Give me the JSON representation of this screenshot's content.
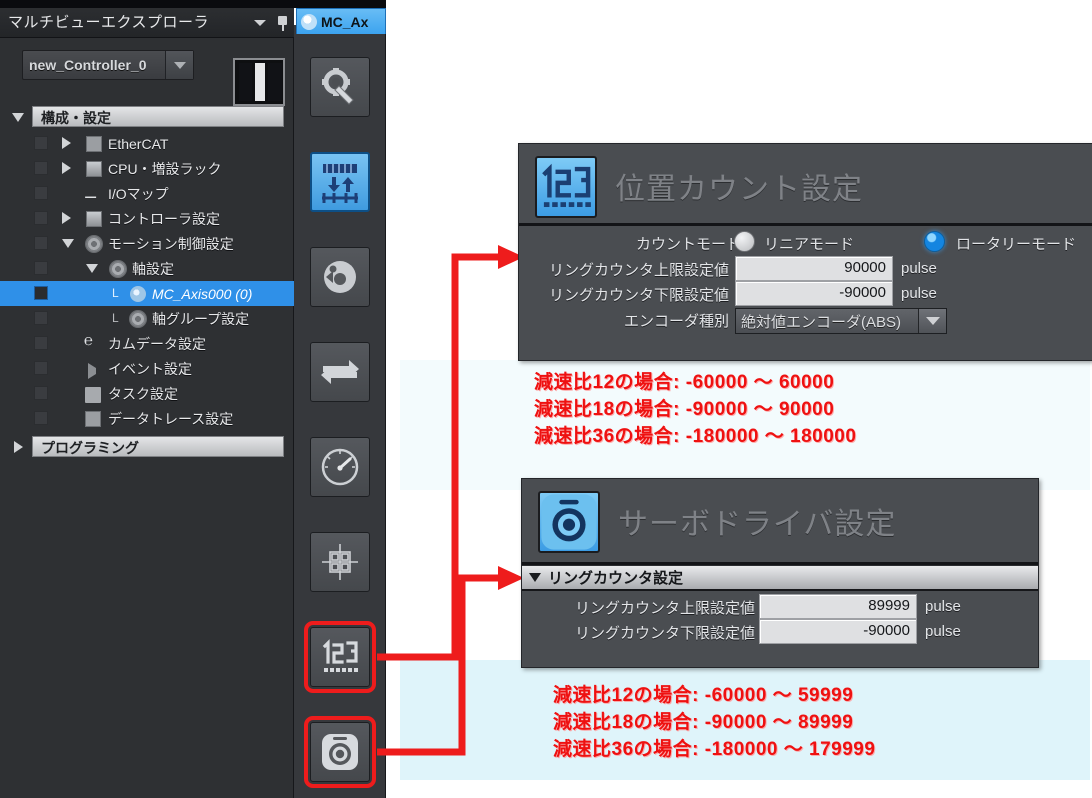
{
  "sidebar": {
    "title": "マルチビューエクスプローラ",
    "collapse_icon": "chevron-down-icon",
    "pin_icon": "pin-icon",
    "controller": {
      "value": "new_Controller_0",
      "dropdown_icon": "chevron-down-icon"
    },
    "tree": [
      {
        "label": "構成・設定",
        "kind": "header",
        "expander": "down",
        "depth": 0,
        "icon": null
      },
      {
        "label": "EtherCAT",
        "kind": "item",
        "expander": "right",
        "depth": 1,
        "icon": "ethercat-icon"
      },
      {
        "label": "CPU・増設ラック",
        "kind": "item",
        "expander": "right",
        "depth": 1,
        "icon": "rack-icon"
      },
      {
        "label": "I/Oマップ",
        "kind": "item",
        "expander": "none",
        "depth": 1,
        "icon": "iomap-icon"
      },
      {
        "label": "コントローラ設定",
        "kind": "item",
        "expander": "right",
        "depth": 1,
        "icon": "controller-icon"
      },
      {
        "label": "モーション制御設定",
        "kind": "item",
        "expander": "down",
        "depth": 1,
        "icon": "motion-icon"
      },
      {
        "label": "軸設定",
        "kind": "item",
        "expander": "down",
        "depth": 2,
        "icon": "axis-settings-icon"
      },
      {
        "label": "MC_Axis000 (0)",
        "kind": "item-selected",
        "expander": "none",
        "depth": 3,
        "icon": "axis-icon"
      },
      {
        "label": "軸グループ設定",
        "kind": "item",
        "expander": "none",
        "depth": 3,
        "icon": "axis-group-icon"
      },
      {
        "label": "カムデータ設定",
        "kind": "item",
        "expander": "none",
        "depth": 2,
        "icon": "cam-icon"
      },
      {
        "label": "イベント設定",
        "kind": "item",
        "expander": "right-small",
        "depth": 2,
        "icon": "event-icon"
      },
      {
        "label": "タスク設定",
        "kind": "item",
        "expander": "none",
        "depth": 2,
        "icon": "task-icon"
      },
      {
        "label": "データトレース設定",
        "kind": "item",
        "expander": "none",
        "depth": 2,
        "icon": "trace-icon"
      },
      {
        "label": "プログラミング",
        "kind": "header",
        "expander": "right",
        "depth": 0,
        "icon": null
      }
    ]
  },
  "tab": {
    "label": "MC_Ax",
    "icon": "axis-icon"
  },
  "rail": {
    "buttons": [
      {
        "name": "axis-basic-settings-button",
        "icon": "gear-wrench-icon",
        "state": "normal"
      },
      {
        "name": "unit-conversion-settings-button",
        "icon": "unit-conversion-icon",
        "state": "selected"
      },
      {
        "name": "operation-settings-button",
        "icon": "operation-icon",
        "state": "normal"
      },
      {
        "name": "homing-settings-button",
        "icon": "two-arrows-icon",
        "state": "normal"
      },
      {
        "name": "servo-gain-settings-button",
        "icon": "gauge-icon",
        "state": "normal"
      },
      {
        "name": "limit-settings-button",
        "icon": "crosshair-grid-icon",
        "state": "normal"
      },
      {
        "name": "position-count-settings-button",
        "icon": "123-counter-icon",
        "state": "highlighted"
      },
      {
        "name": "servo-driver-settings-button",
        "icon": "servo-driver-icon",
        "state": "highlighted"
      }
    ]
  },
  "position_count_dialog": {
    "title": "位置カウント設定",
    "icon": "123-counter-icon",
    "count_mode": {
      "label": "カウントモード",
      "options": [
        {
          "label": "リニアモード",
          "selected": false
        },
        {
          "label": "ロータリーモード",
          "selected": true
        }
      ]
    },
    "fields": [
      {
        "label": "リングカウンタ上限設定値",
        "value": "90000",
        "unit": "pulse"
      },
      {
        "label": "リングカウンタ下限設定値",
        "value": "-90000",
        "unit": "pulse"
      }
    ],
    "encoder": {
      "label": "エンコーダ種別",
      "value": "絶対値エンコーダ(ABS)",
      "dropdown_icon": "chevron-down-icon"
    }
  },
  "position_count_notes": [
    "減速比12の場合: -60000 ～ 60000",
    "減速比18の場合: -90000 ～ 90000",
    "減速比36の場合: -180000 ～ 180000"
  ],
  "servo_driver_dialog": {
    "title": "サーボドライバ設定",
    "icon": "servo-driver-icon",
    "section": {
      "label": "リングカウンタ設定",
      "expander": "down"
    },
    "fields": [
      {
        "label": "リングカウンタ上限設定値",
        "value": "89999",
        "unit": "pulse"
      },
      {
        "label": "リングカウンタ下限設定値",
        "value": "-90000",
        "unit": "pulse"
      }
    ]
  },
  "servo_driver_notes": [
    "減速比12の場合: -60000 ～ 59999",
    "減速比18の場合: -90000 ～ 89999",
    "減速比36の場合: -180000 ～ 179999"
  ],
  "colors": {
    "annotation_red": "#ee1111",
    "selection_blue": "#2f90e8",
    "panel_dark": "#4a4d51",
    "shell_dark": "#2e3033",
    "accent_icon_blue": "#3c9ce4"
  }
}
